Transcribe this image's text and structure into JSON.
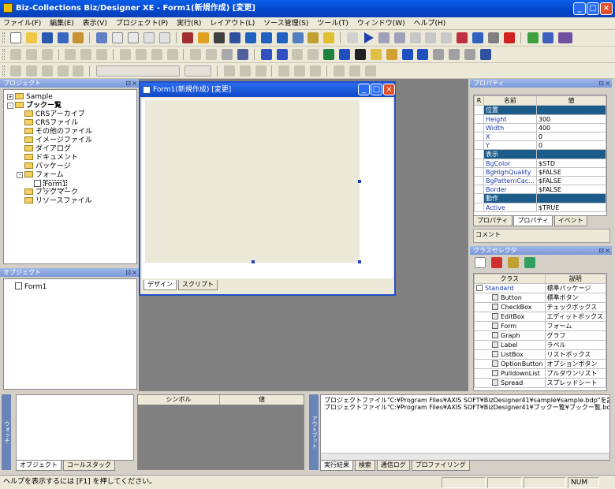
{
  "window": {
    "title": "Biz-Collections Biz/Designer XE - Form1(新規作成) [変更]"
  },
  "menu": [
    "ファイル(F)",
    "編集(E)",
    "表示(V)",
    "プロジェクト(P)",
    "実行(R)",
    "レイアウト(L)",
    "ソース管理(S)",
    "ツール(T)",
    "ウィンドウ(W)",
    "ヘルプ(H)"
  ],
  "project_panel": {
    "title": "プロジェクト",
    "tree": [
      {
        "label": "Sample",
        "level": 0,
        "expander": "+",
        "icon": "folder"
      },
      {
        "label": "ブックー覧",
        "level": 0,
        "expander": "-",
        "icon": "folder",
        "bold": true
      },
      {
        "label": "CRSアーカイブ",
        "level": 1,
        "icon": "folder"
      },
      {
        "label": "CRSファイル",
        "level": 1,
        "icon": "folder"
      },
      {
        "label": "その他のファイル",
        "level": 1,
        "icon": "folder"
      },
      {
        "label": "イメージファイル",
        "level": 1,
        "icon": "folder"
      },
      {
        "label": "ダイアログ",
        "level": 1,
        "icon": "folder"
      },
      {
        "label": "ドキュメント",
        "level": 1,
        "icon": "folder"
      },
      {
        "label": "パッケージ",
        "level": 1,
        "icon": "folder"
      },
      {
        "label": "フォーム",
        "level": 1,
        "expander": "-",
        "icon": "folder"
      },
      {
        "label": "Form1",
        "level": 2,
        "icon": "doc",
        "selected": true
      },
      {
        "label": "ブックマーク",
        "level": 1,
        "icon": "folder"
      },
      {
        "label": "リソースファイル",
        "level": 1,
        "icon": "folder"
      }
    ]
  },
  "object_panel": {
    "title": "オブジェクト",
    "items": [
      "Form1"
    ]
  },
  "form_window": {
    "title": "Form1(新規作成) [変更]",
    "tabs": [
      "デザイン",
      "スクリプト"
    ]
  },
  "property_panel": {
    "title": "プロパティ",
    "col_r": "R",
    "col_name": "名前",
    "col_value": "値",
    "rows": [
      {
        "type": "cat",
        "name": "位置"
      },
      {
        "name": "Height",
        "value": "300"
      },
      {
        "name": "Width",
        "value": "400"
      },
      {
        "name": "X",
        "value": "0"
      },
      {
        "name": "Y",
        "value": "0"
      },
      {
        "type": "cat",
        "name": "表示"
      },
      {
        "name": "BgColor",
        "value": "$STD"
      },
      {
        "name": "BgHighQuality",
        "value": "$FALSE"
      },
      {
        "name": "BgPatternCac...",
        "value": "$FALSE"
      },
      {
        "name": "Border",
        "value": "$FALSE"
      },
      {
        "type": "cat",
        "name": "動作"
      },
      {
        "name": "Active",
        "value": "$TRUE"
      }
    ],
    "tabs": [
      "プロパティ",
      "プロパティ",
      "イベント"
    ],
    "comment_label": "コメント"
  },
  "class_panel": {
    "title": "クラスセレクタ",
    "col_class": "クラス",
    "col_desc": "説明",
    "rows": [
      {
        "name": "Standard",
        "desc": "標準パッケージ",
        "group": true
      },
      {
        "name": "Button",
        "desc": "標準ボタン"
      },
      {
        "name": "CheckBox",
        "desc": "チェックボックス"
      },
      {
        "name": "EditBox",
        "desc": "エディットボックス"
      },
      {
        "name": "Form",
        "desc": "フォーム"
      },
      {
        "name": "Graph",
        "desc": "グラフ"
      },
      {
        "name": "Label",
        "desc": "ラベル"
      },
      {
        "name": "ListBox",
        "desc": "リストボックス"
      },
      {
        "name": "OptionButton",
        "desc": "オプションボタン"
      },
      {
        "name": "PulldownList",
        "desc": "プルダウンリスト"
      },
      {
        "name": "Spread",
        "desc": "スプレッドシート"
      }
    ]
  },
  "watch_panel": {
    "side_label": "ウォッチ",
    "tabs": [
      "オブジェクト",
      "コールスタック"
    ],
    "col_symbol": "シンボル",
    "col_value": "値"
  },
  "output_panel": {
    "side_label": "アウトプット",
    "lines": [
      "プロジェクトファイル\"C:¥Program Files¥AXIS SOFT¥BizDesigner41¥sample¥sample.bdp\"を読み込み中 完",
      "プロジェクトファイル\"C:¥Program Files¥AXIS SOFT¥BizDesigner41¥ブックー覧¥ブックー覧.bdp\"を読み込み"
    ],
    "tabs": [
      "実行結果",
      "検索",
      "通信ログ",
      "プロファイリング"
    ]
  },
  "status": {
    "text": "ヘルプを表示するには [F1] を押してください。",
    "num": "NUM"
  }
}
